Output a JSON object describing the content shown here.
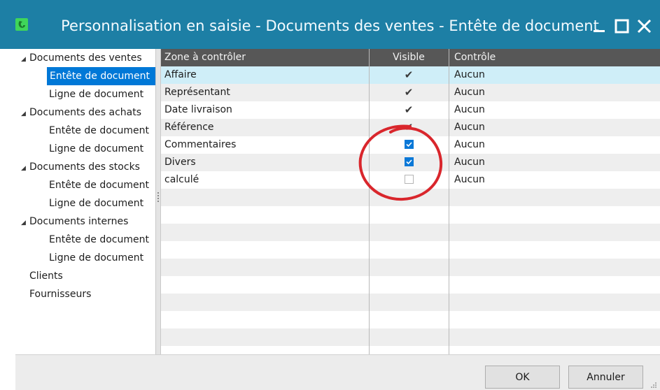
{
  "window": {
    "title": "Personnalisation en saisie - Documents des ventes - Entête de document",
    "accent_color": "#1d7fa5",
    "controls": [
      "minimize-icon",
      "maximize-icon",
      "close-icon"
    ]
  },
  "tree": {
    "items": [
      {
        "label": "Documents des ventes",
        "level": 0,
        "expanded": true
      },
      {
        "label": "Entête de document",
        "level": 1,
        "selected": true
      },
      {
        "label": "Ligne de document",
        "level": 1
      },
      {
        "label": "Documents des achats",
        "level": 0,
        "expanded": true
      },
      {
        "label": "Entête de document",
        "level": 1
      },
      {
        "label": "Ligne de document",
        "level": 1
      },
      {
        "label": "Documents des stocks",
        "level": 0,
        "expanded": true
      },
      {
        "label": "Entête de document",
        "level": 1
      },
      {
        "label": "Ligne de document",
        "level": 1
      },
      {
        "label": "Documents internes",
        "level": 0,
        "expanded": true
      },
      {
        "label": "Entête de document",
        "level": 1
      },
      {
        "label": "Ligne de document",
        "level": 1
      },
      {
        "label": "Clients",
        "level": 0
      },
      {
        "label": "Fournisseurs",
        "level": 0
      }
    ]
  },
  "grid": {
    "columns": [
      "Zone à contrôler",
      "Visible",
      "Contrôle"
    ],
    "rows": [
      {
        "zone": "Affaire",
        "visible": "check",
        "controle": "Aucun"
      },
      {
        "zone": "Représentant",
        "visible": "check",
        "controle": "Aucun"
      },
      {
        "zone": "Date livraison",
        "visible": "check",
        "controle": "Aucun"
      },
      {
        "zone": "Référence",
        "visible": "check",
        "controle": "Aucun"
      },
      {
        "zone": "Commentaires",
        "visible": "checkbox-checked",
        "controle": "Aucun"
      },
      {
        "zone": "Divers",
        "visible": "checkbox-checked",
        "controle": "Aucun"
      },
      {
        "zone": "calculé",
        "visible": "checkbox-unchecked",
        "controle": "Aucun"
      }
    ],
    "check_glyph": "✔"
  },
  "footer": {
    "ok_label": "OK",
    "cancel_label": "Annuler"
  },
  "annotation_color": "#d9262c"
}
